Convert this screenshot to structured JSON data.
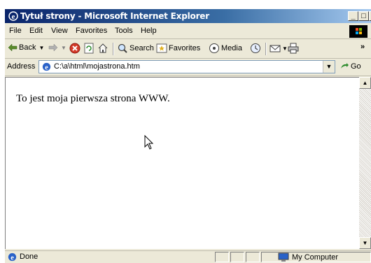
{
  "window": {
    "title": "Tytuł strony - Microsoft Internet Explorer",
    "minimize_label": "_",
    "maximize_label": "□",
    "close_label": "×"
  },
  "menu": {
    "items": [
      "File",
      "Edit",
      "View",
      "Favorites",
      "Tools",
      "Help"
    ]
  },
  "toolbar": {
    "back_label": "Back",
    "search_label": "Search",
    "favorites_label": "Favorites",
    "media_label": "Media",
    "more_label": "»"
  },
  "address": {
    "label": "Address",
    "value": "C:\\a\\html\\mojastrona.htm",
    "go_label": "Go"
  },
  "content": {
    "text": "To jest moja pierwsza strona WWW."
  },
  "status": {
    "text": "Done",
    "zone": "My Computer"
  },
  "colors": {
    "titlebar_start": "#0a246a",
    "titlebar_end": "#a6caf0",
    "chrome": "#ece9d8"
  }
}
